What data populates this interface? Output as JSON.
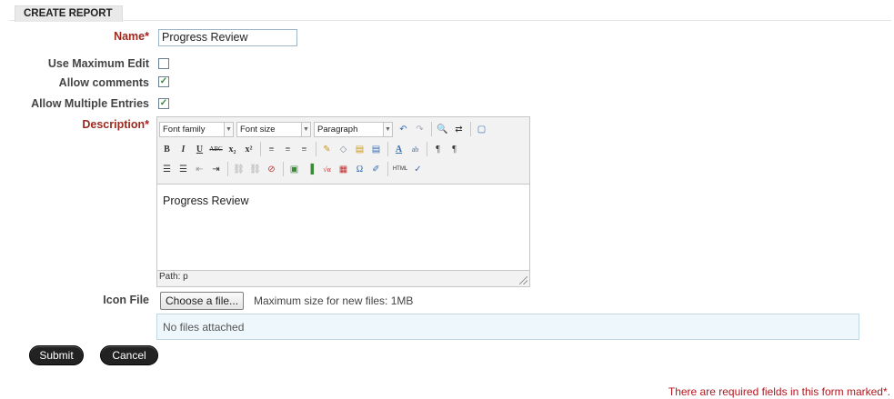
{
  "section": {
    "title": "CREATE REPORT"
  },
  "fields": {
    "name": {
      "label": "Name",
      "value": "Progress Review"
    },
    "use_max_edit": {
      "label": "Use Maximum Edit",
      "checked": false
    },
    "allow_comments": {
      "label": "Allow comments",
      "checked": true
    },
    "allow_multiple": {
      "label": "Allow Multiple Entries",
      "checked": true
    },
    "description": {
      "label": "Description",
      "font_family": "Font family",
      "font_size": "Font size",
      "format": "Paragraph",
      "content": "Progress Review",
      "path": "Path: p"
    },
    "icon_file": {
      "label": "Icon File",
      "button": "Choose a file...",
      "max_size": "Maximum size for new files: 1MB",
      "attached": "No files attached"
    }
  },
  "required_mark": "*",
  "actions": {
    "submit": "Submit",
    "cancel": "Cancel"
  },
  "footer_note": "There are required fields in this form marked",
  "checkbox_check": "✓",
  "toolbar": {
    "row1": [
      "↶",
      "↷",
      "🔍",
      "⇄",
      "▢"
    ],
    "row2": [
      "B",
      "I",
      "U",
      "ABC",
      "x₂",
      "x²",
      "≡",
      "≡",
      "≡",
      "✎",
      "◇",
      "▤",
      "▤",
      "A",
      "ab",
      "¶",
      "¶"
    ],
    "row3": [
      "☰",
      "☰",
      "⇤",
      "⇥",
      "⛓",
      "⛓",
      "⊘",
      "▣",
      "▐",
      "√α",
      "▦",
      "Ω",
      "✐",
      "HTML",
      "✓"
    ]
  }
}
